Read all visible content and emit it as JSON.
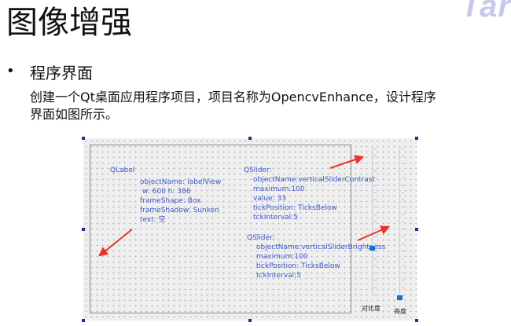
{
  "brand": "Tar",
  "page_title": "图像增强",
  "section": {
    "bullet": "•",
    "heading": "程序界面"
  },
  "description": [
    "创建一个Qt桌面应用程序项目，项目名称为OpencvEnhance，设计程序",
    "界面如图所示。"
  ],
  "label_view_annotation": {
    "title": "QLabel",
    "lines": [
      "objectName: labelView",
      "w: 600  h: 386",
      "frameShape: Box",
      "frameShadow: Sunken",
      "text: 空"
    ]
  },
  "contrast_slider_annotation": {
    "title": "QSlider:",
    "lines": [
      "objectName:verticalSliderContrast",
      "maximum:100",
      "value: 33",
      "tickPosition: TicksBelow",
      "tckInterval:5"
    ]
  },
  "brightness_slider_annotation": {
    "title": "QSlider:",
    "lines": [
      "objectName:verticalSliderBrightness",
      "maximum:100",
      "tickPosition: TicksBelow",
      "tckInterval:5"
    ]
  },
  "slider_labels": {
    "contrast": "对比度",
    "brightness": "亮度"
  },
  "sliders": {
    "contrast_value": 33,
    "brightness_value": 0,
    "maximum": 100
  },
  "colors": {
    "annotation": "#3a58c9",
    "arrow": "#e8322a",
    "handle": "#1f2f8f",
    "slider_knob": "#1273d4"
  }
}
